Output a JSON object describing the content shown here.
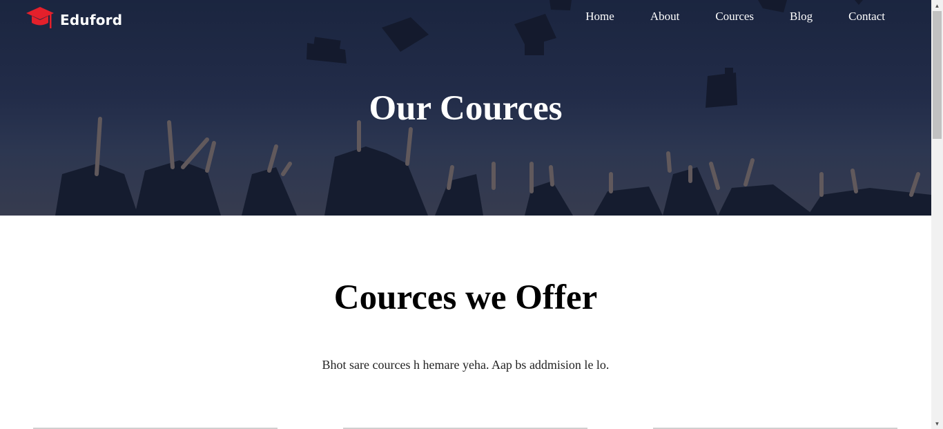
{
  "brand": {
    "name": "Eduford",
    "accent_color": "#e4202b",
    "icon": "graduation-cap-icon"
  },
  "nav": {
    "items": [
      "Home",
      "About",
      "Cources",
      "Blog",
      "Contact"
    ]
  },
  "hero": {
    "title": "Our Cources"
  },
  "offer": {
    "title": "Cources we Offer",
    "description": "Bhot sare cources h hemare yeha. Aap bs addmision le lo."
  }
}
